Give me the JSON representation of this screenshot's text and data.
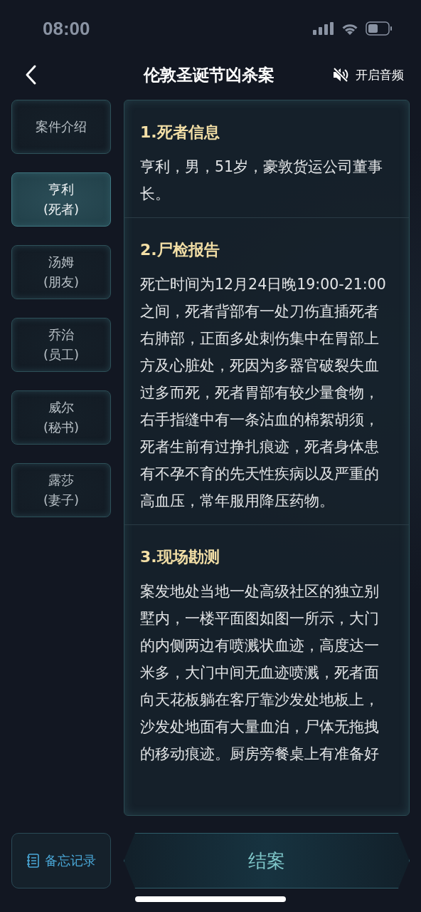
{
  "status_bar": {
    "time": "08:00"
  },
  "nav": {
    "title": "伦敦圣诞节凶杀案",
    "audio_label": "开启音频",
    "audio_on": false
  },
  "sidebar": {
    "items": [
      {
        "label": "案件介绍",
        "selected": false
      },
      {
        "label": "亨利",
        "sublabel": "(死者)",
        "selected": true
      },
      {
        "label": "汤姆",
        "sublabel": "(朋友)",
        "selected": false
      },
      {
        "label": "乔治",
        "sublabel": "(员工)",
        "selected": false
      },
      {
        "label": "威尔",
        "sublabel": "(秘书)",
        "selected": false
      },
      {
        "label": "露莎",
        "sublabel": "(妻子)",
        "selected": false
      }
    ]
  },
  "sections": [
    {
      "heading": "1.死者信息",
      "body": "亨利，男，51岁，豪敦货运公司董事长。"
    },
    {
      "heading": "2.尸检报告",
      "body": "死亡时间为12月24日晚19:00-21:00之间，死者背部有一处刀伤直插死者右肺部，正面多处刺伤集中在胃部上方及心脏处，死因为多器官破裂失血过多而死，死者胃部有较少量食物，右手指缝中有一条沾血的棉絮胡须，死者生前有过挣扎痕迹，死者身体患有不孕不育的先天性疾病以及严重的高血压，常年服用降压药物。"
    },
    {
      "heading": "3.现场勘测",
      "body": "案发地处当地一处高级社区的独立别墅内，一楼平面图如图一所示，大门的内侧两边有喷溅状血迹，高度达一米多，大门中间无血迹喷溅，死者面向天花板躺在客厅靠沙发处地板上，沙发处地面有大量血泊，尸体无拖拽的移动痕迹。厨房旁餐桌上有准备好"
    }
  ],
  "footer": {
    "notes_button": "备忘记录",
    "close_button": "结案"
  }
}
